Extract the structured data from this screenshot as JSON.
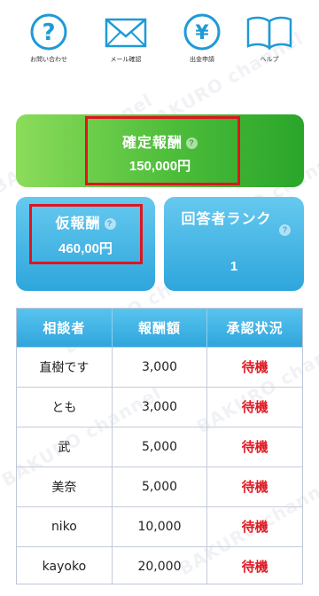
{
  "watermark_text": "BAKURO channel",
  "nav": [
    {
      "label": "お問い合わせ",
      "icon": "question-circle-icon"
    },
    {
      "label": "メール確認",
      "icon": "mail-envelope-icon"
    },
    {
      "label": "出金申請",
      "icon": "yen-circle-icon"
    },
    {
      "label": "ヘルプ",
      "icon": "open-book-icon"
    }
  ],
  "confirmed": {
    "title": "確定報酬",
    "value": "150,000円"
  },
  "tentative": {
    "title": "仮報酬",
    "value": "460,00円"
  },
  "rank": {
    "title": "回答者ランク",
    "value": "1"
  },
  "help_glyph": "?",
  "table": {
    "headers": [
      "相談者",
      "報酬額",
      "承認状況"
    ],
    "rows": [
      [
        "直樹です",
        "3,000",
        "待機"
      ],
      [
        "とも",
        "3,000",
        "待機"
      ],
      [
        "武",
        "5,000",
        "待機"
      ],
      [
        "美奈",
        "5,000",
        "待機"
      ],
      [
        "niko",
        "10,000",
        "待機"
      ],
      [
        "kayoko",
        "20,000",
        "待機"
      ]
    ]
  },
  "colors": {
    "accent_blue": "#1f9ad6",
    "green": "#4cbd3a",
    "status_red": "#e01b24",
    "highlight_red": "#e0141e"
  }
}
